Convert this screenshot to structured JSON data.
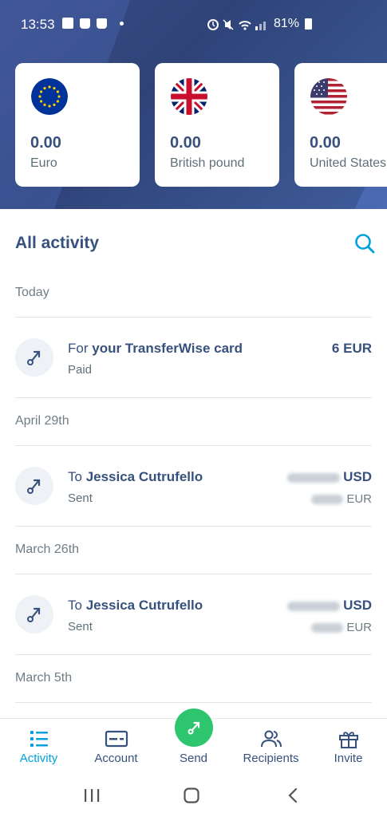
{
  "status": {
    "time": "13:53",
    "battery": "81%"
  },
  "balances": [
    {
      "amount": "0.00",
      "currency": "Euro",
      "flag": "eu-flag-icon"
    },
    {
      "amount": "0.00",
      "currency": "British pound",
      "flag": "uk-flag-icon"
    },
    {
      "amount": "0.00",
      "currency": "United States",
      "flag": "us-flag-icon"
    }
  ],
  "activity": {
    "title": "All activity",
    "groups": [
      {
        "date": "Today",
        "tx": {
          "prefix": "For ",
          "name": "your TransferWise card",
          "status": "Paid",
          "amount": "6 EUR",
          "amount2": ""
        }
      },
      {
        "date": "April 29th",
        "tx": {
          "prefix": "To ",
          "name": "Jessica Cutrufello",
          "status": "Sent",
          "amount": "USD",
          "amount2": "EUR"
        }
      },
      {
        "date": "March 26th",
        "tx": {
          "prefix": "To ",
          "name": "Jessica Cutrufello",
          "status": "Sent",
          "amount": "USD",
          "amount2": "EUR"
        }
      },
      {
        "date": "March 5th"
      }
    ]
  },
  "nav": {
    "activity": "Activity",
    "account": "Account",
    "send": "Send",
    "recipients": "Recipients",
    "invite": "Invite"
  },
  "colors": {
    "accent": "#00a2dd",
    "send": "#2ec56f",
    "text": "#37517e"
  }
}
